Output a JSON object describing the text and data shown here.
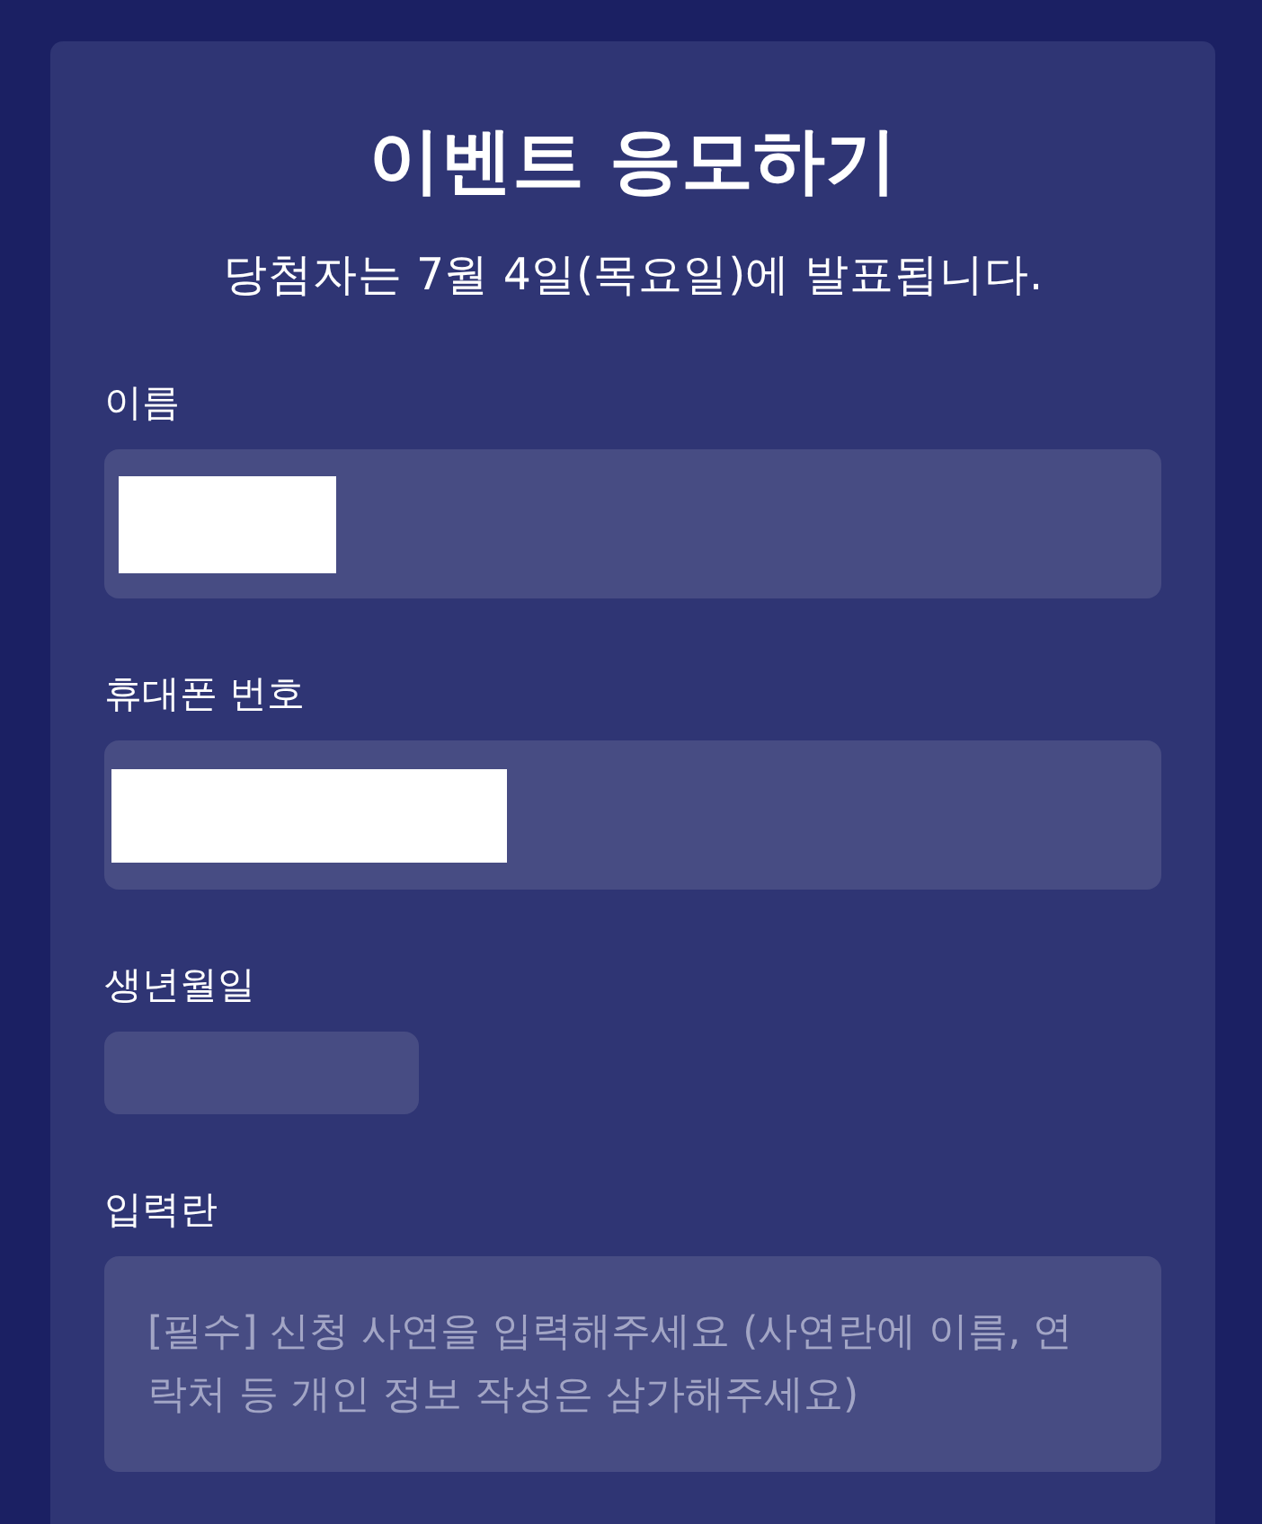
{
  "header": {
    "title": "이벤트 응모하기",
    "subtitle": "당첨자는 7월 4일(목요일)에 발표됩니다."
  },
  "fields": [
    {
      "kind": "text",
      "label": "이름",
      "redacted": true
    },
    {
      "kind": "tel",
      "label": "휴대폰 번호",
      "redacted": true
    },
    {
      "kind": "date",
      "label": "생년월일"
    },
    {
      "kind": "textarea",
      "label": "입력란",
      "placeholder": "[필수] 신청 사연을 입력해주세요 (사연란에 이름, 연락처 등 개인 정보 작성은 삼가해주세요)"
    }
  ]
}
